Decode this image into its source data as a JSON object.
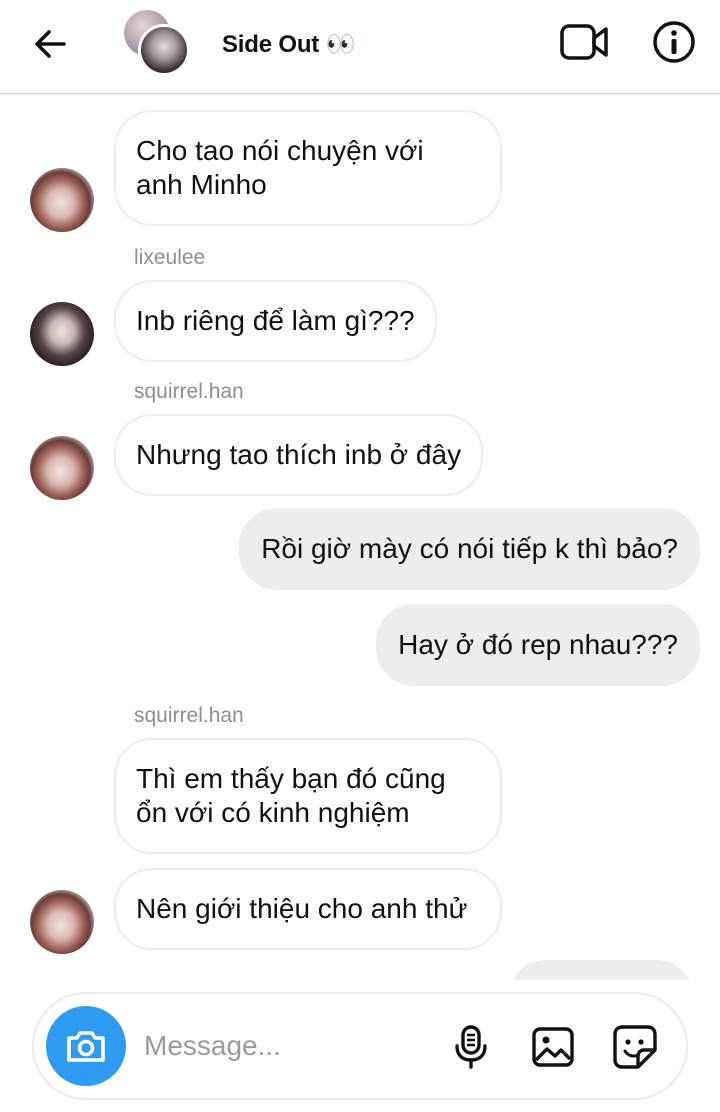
{
  "header": {
    "title": "Side Out 👀",
    "back_icon": "arrow-left-icon",
    "video_icon": "video-call-icon",
    "info_icon": "info-icon"
  },
  "messages": [
    {
      "id": "m1",
      "sender": "",
      "text_lines": [
        "Cho tao nói chuyện với",
        "anh Minho"
      ],
      "direction": "incoming",
      "avatar": "squirrel.han"
    },
    {
      "id": "m2",
      "sender": "lixeulee",
      "text_lines": [
        "Inb riêng để làm gì???"
      ],
      "direction": "incoming",
      "avatar": "lixeulee"
    },
    {
      "id": "m3",
      "sender": "squirrel.han",
      "text_lines": [
        "Nhưng tao thích inb ở đây"
      ],
      "direction": "incoming",
      "avatar": "squirrel.han"
    },
    {
      "id": "m4",
      "text_lines": [
        "Rồi giờ mày có nói tiếp k thì bảo?"
      ],
      "direction": "outgoing"
    },
    {
      "id": "m5",
      "text_lines": [
        "Hay ở đó rep nhau???"
      ],
      "direction": "outgoing"
    },
    {
      "id": "m6",
      "sender": "squirrel.han",
      "text_lines": [
        "Thì em thấy bạn đó cũng",
        "ổn với có kinh nghiệm"
      ],
      "direction": "incoming"
    },
    {
      "id": "m7",
      "text_lines": [
        "Nên giới thiệu cho anh thử"
      ],
      "direction": "incoming",
      "avatar": "squirrel.han"
    }
  ],
  "composer": {
    "placeholder": "Message...",
    "camera_icon": "camera-icon",
    "mic_icon": "microphone-icon",
    "gallery_icon": "image-icon",
    "sticker_icon": "sticker-icon"
  },
  "colors": {
    "accent": "#2f9bf0",
    "outgoing_bubble": "#ededed",
    "incoming_border": "#ededed",
    "secondary_text": "#8e8e8e"
  }
}
